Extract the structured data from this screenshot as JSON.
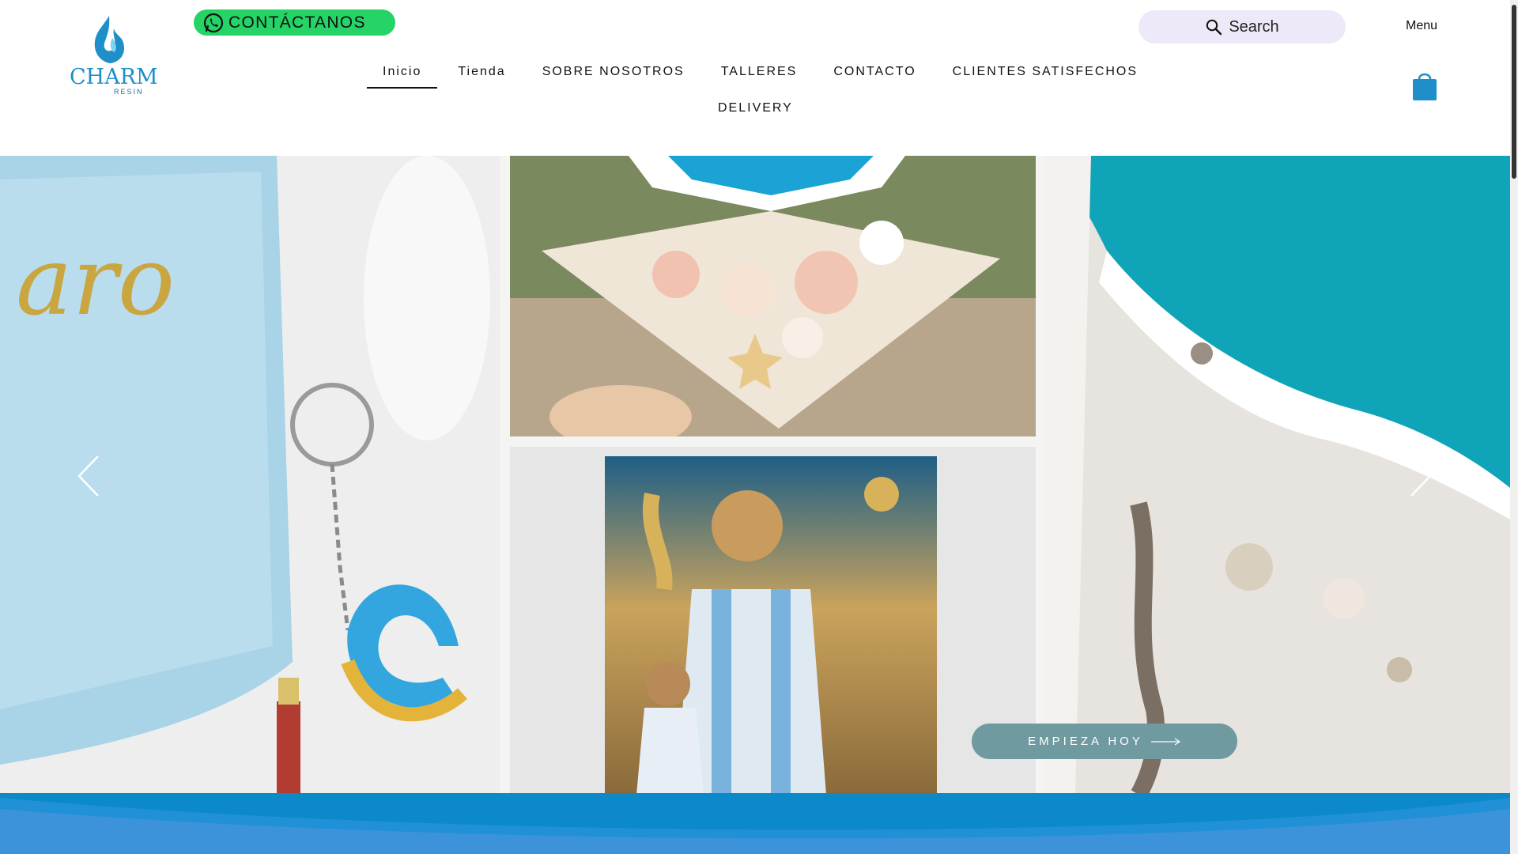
{
  "brand": {
    "name": "CHARM",
    "sub": "RESIN"
  },
  "header": {
    "contact_label": "CONTÁCTANOS",
    "search_placeholder": "Search",
    "menu_label": "Menu"
  },
  "nav": {
    "items": [
      {
        "label": "Inicio",
        "active": true
      },
      {
        "label": "Tienda"
      },
      {
        "label": "SOBRE NOSOTROS"
      },
      {
        "label": "TALLERES"
      },
      {
        "label": "CONTACTO"
      },
      {
        "label": "CLIENTES SATISFECHOS"
      },
      {
        "label": "DELIVERY"
      }
    ]
  },
  "hero": {
    "cta_label": "EMPIEZA HOY",
    "panels": [
      "resin keychain and tray",
      "seashell pyramid",
      "football poster in resin",
      "ocean resin art"
    ]
  },
  "colors": {
    "accent_green": "#25d366",
    "brand_blue": "#1f8fc9",
    "cta_teal": "#6e9aa0",
    "wave_blue": "#1590d6",
    "search_bg": "#ede9f8"
  },
  "icons": [
    "whatsapp-icon",
    "search-icon",
    "cart-icon",
    "chevron-left-icon",
    "chevron-right-icon",
    "arrow-right-icon",
    "logo-flame-icon"
  ]
}
